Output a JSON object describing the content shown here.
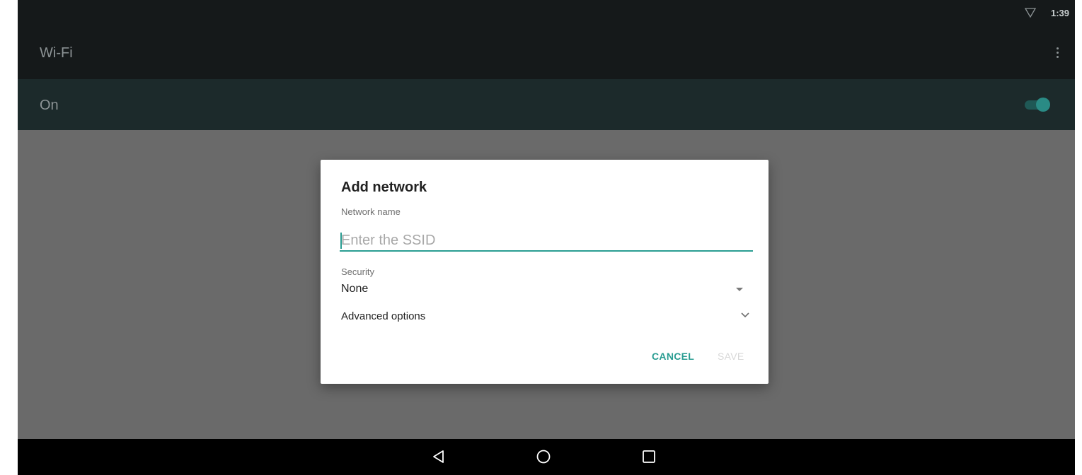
{
  "status_bar": {
    "time": "1:39",
    "wifi_icon": "wifi-outline-icon"
  },
  "toolbar": {
    "title": "Wi-Fi",
    "overflow_icon": "more-vert-icon"
  },
  "switch_bar": {
    "label": "On",
    "switch_state": "on"
  },
  "dialog": {
    "title": "Add network",
    "network_name_label": "Network name",
    "ssid_value": "",
    "ssid_placeholder": "Enter the SSID",
    "security_label": "Security",
    "security_value": "None",
    "advanced_label": "Advanced options",
    "cancel_label": "CANCEL",
    "save_label": "SAVE"
  },
  "nav_bar": {
    "icons": [
      "back-icon",
      "home-icon",
      "recents-icon"
    ]
  },
  "colors": {
    "accent": "#2a9d92",
    "toolbar_bg": "#15191a",
    "switchbar_bg": "#1c2a2b",
    "scrim": "#6a6a6a",
    "disabled_text": "#d8d8d8"
  }
}
